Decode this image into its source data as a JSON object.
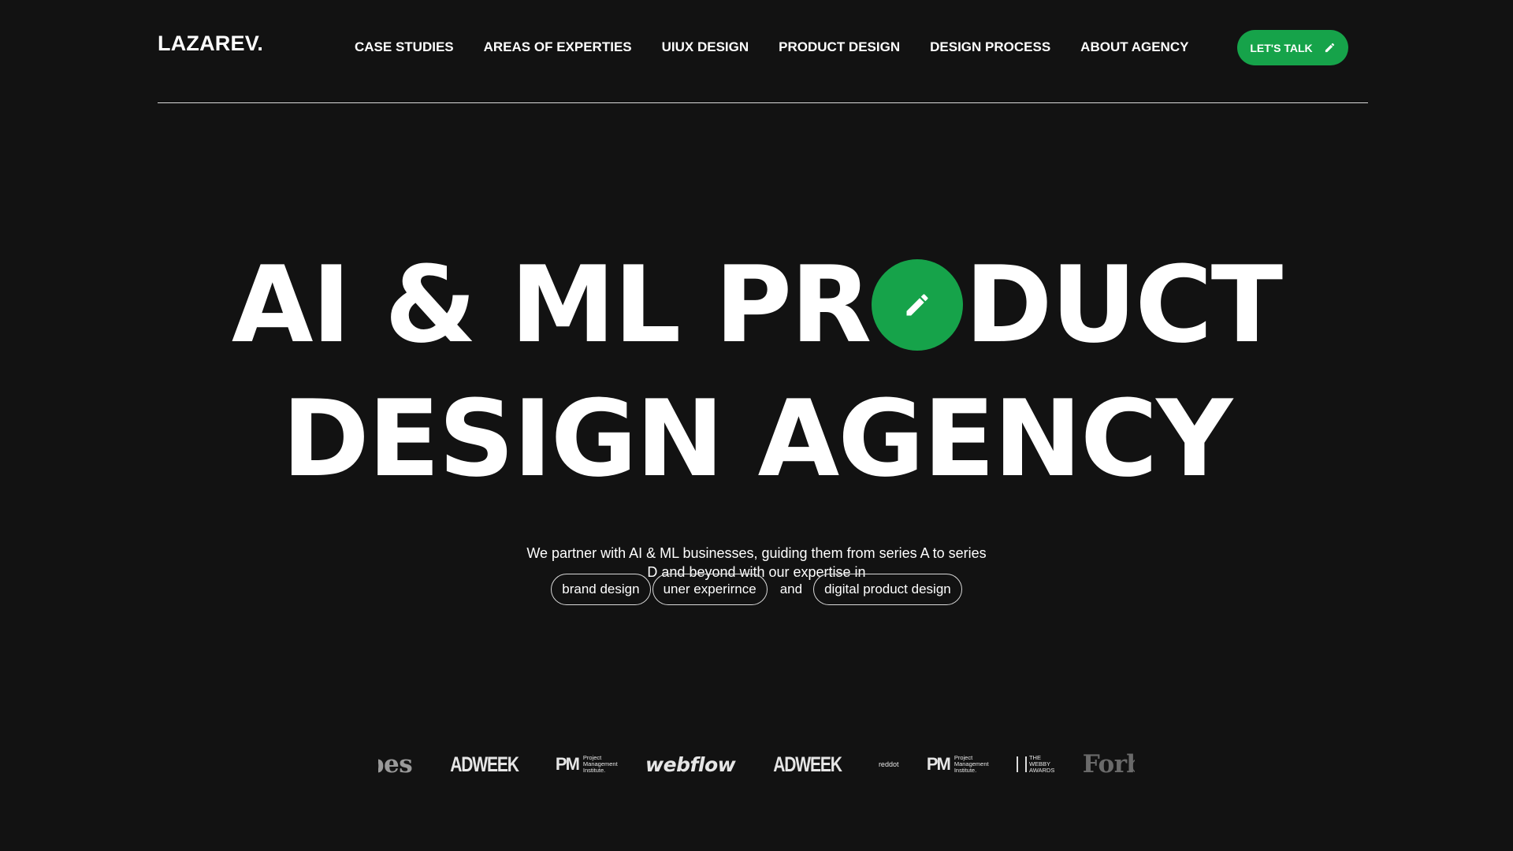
{
  "header": {
    "logo": "LAZAREV.",
    "nav": [
      "CASE STUDIES",
      "AREAS OF EXPERTIES",
      "UIUX DESIGN",
      "PRODUCT DESIGN",
      "DESIGN PROCESS",
      "ABOUT AGENCY"
    ],
    "cta_label": "LET'S TALK",
    "cta_icon": "pencil-icon"
  },
  "hero": {
    "line1_before": "AI & ML PR",
    "line1_after": "DUCT",
    "line2": "DESIGN AGENCY",
    "o_icon": "pencil-icon"
  },
  "intro": {
    "text": "We partner with AI & ML businesses, guiding them from series A to series D and beyond with our expertise in",
    "tag1": "brand design",
    "tag2": "uner experirnce",
    "conjunction": "and",
    "tag3": "digital product design"
  },
  "logos": {
    "forbes_left": "rbes",
    "adweek1": "ADWEEK",
    "pmi1_mark": "PM",
    "pmi1_lines": [
      "Project",
      "Management",
      "Institute."
    ],
    "webflow": "webflow",
    "adweek2": "ADWEEK",
    "reddot": "reddot",
    "pmi2_mark": "PM",
    "pmi2_lines": [
      "Project",
      "Management",
      "Institute."
    ],
    "webby_lines": [
      "THE",
      "WEBBY",
      "AWARDS"
    ],
    "forbes_right": "Forbe"
  },
  "colors": {
    "background": "#121212",
    "accent_green": "#16a34a",
    "text": "#ffffff"
  }
}
